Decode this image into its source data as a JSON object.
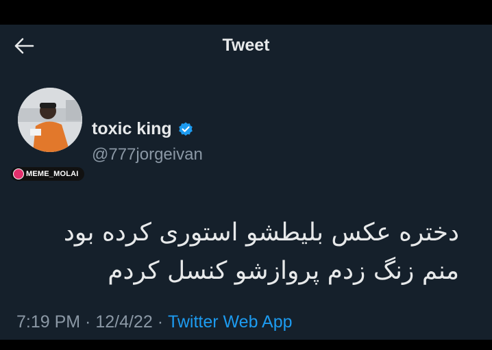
{
  "header": {
    "title": "Tweet"
  },
  "author": {
    "display_name": "toxic king",
    "handle": "@777jorgeivan",
    "verified": true
  },
  "watermark": {
    "text": "MEME_MOLAI"
  },
  "tweet": {
    "line1": "دختره عکس بلیطشو استوری کرده بود",
    "line2": "منم زنگ زدم پروازشو کنسل کردم"
  },
  "meta": {
    "time": "7:19 PM",
    "sep1": " · ",
    "date": "12/4/22",
    "sep2": " · ",
    "source": "Twitter Web App"
  },
  "colors": {
    "background": "#15202b",
    "text": "#e7e9ea",
    "secondary": "#8b98a5",
    "link": "#1d9bf0"
  },
  "icons": {
    "back": "arrow-left-icon",
    "verified": "verified-badge-icon"
  }
}
